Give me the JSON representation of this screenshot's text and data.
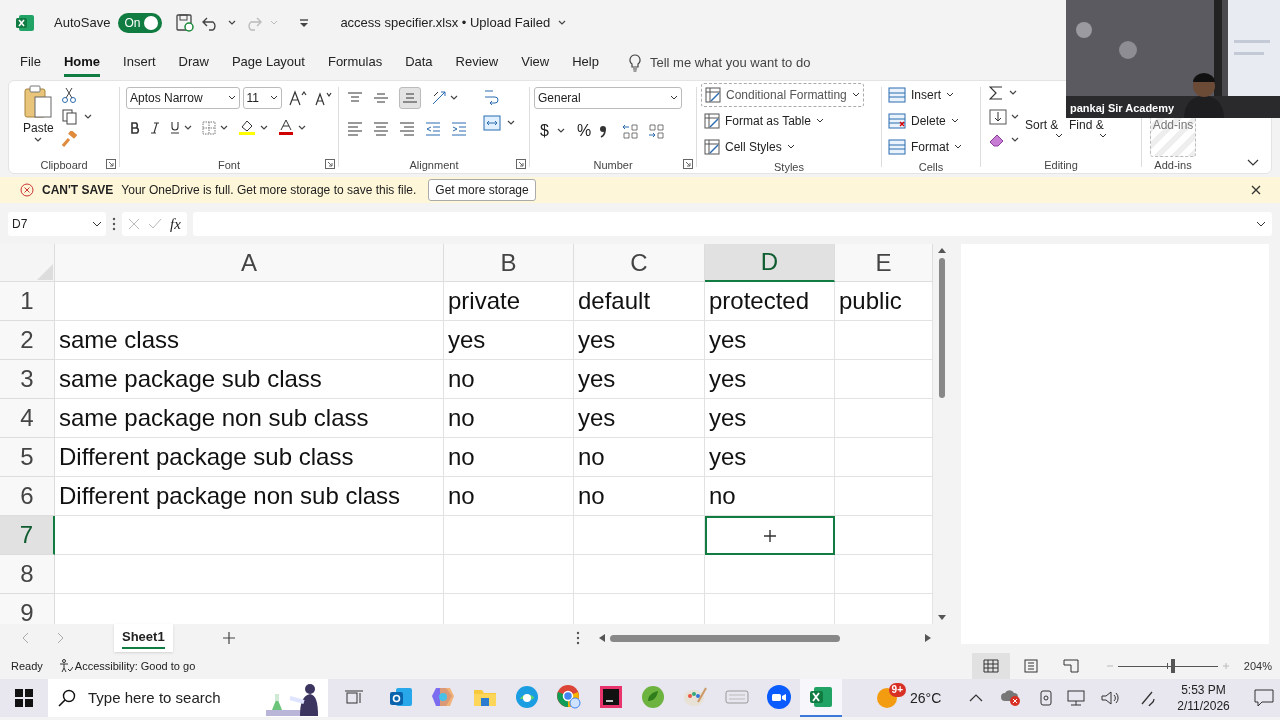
{
  "title_bar": {
    "autosave_label": "AutoSave",
    "autosave": {
      "on": true,
      "label": "On"
    },
    "document_title": "access specifier.xlsx • Upload Failed"
  },
  "menu_tabs": [
    {
      "label": "File",
      "selected": false
    },
    {
      "label": "Home",
      "selected": true
    },
    {
      "label": "Insert",
      "selected": false
    },
    {
      "label": "Draw",
      "selected": false
    },
    {
      "label": "Page Layout",
      "selected": false
    },
    {
      "label": "Formulas",
      "selected": false
    },
    {
      "label": "Data",
      "selected": false
    },
    {
      "label": "Review",
      "selected": false
    },
    {
      "label": "View",
      "selected": false
    },
    {
      "label": "Help",
      "selected": false
    }
  ],
  "tell_me": {
    "placeholder": "Tell me what you want to do"
  },
  "ribbon": {
    "clipboard": {
      "paste_label": "Paste",
      "group_label": "Clipboard"
    },
    "font": {
      "font_name": "Aptos Narrow",
      "font_size": "11",
      "group_label": "Font"
    },
    "alignment": {
      "group_label": "Alignment"
    },
    "number": {
      "format": "General",
      "currency": "$",
      "percent": "%",
      "group_label": "Number"
    },
    "styles": {
      "commands": [
        "Conditional Formatting",
        "Format as Table",
        "Cell Styles"
      ],
      "group_label": "Styles"
    },
    "cells": {
      "commands": [
        "Insert",
        "Delete",
        "Format"
      ],
      "group_label": "Cells"
    },
    "editing": {
      "commands": [
        "Sort &",
        "Find &"
      ],
      "group_label": "Editing"
    },
    "add_ins": {
      "command": "Add-ins",
      "group_label": "Add-ins"
    }
  },
  "message_bar": {
    "title": "CAN'T SAVE",
    "text": "Your OneDrive is full. Get more storage to save this file.",
    "button": "Get more storage"
  },
  "formula_bar": {
    "name_box": "D7",
    "function_label": "fx"
  },
  "sheet": {
    "columns": [
      {
        "label": "A",
        "selected": false
      },
      {
        "label": "B",
        "selected": false
      },
      {
        "label": "C",
        "selected": false
      },
      {
        "label": "D",
        "selected": true
      },
      {
        "label": "E",
        "selected": false
      }
    ],
    "rows": [
      {
        "number": "1",
        "selected": false,
        "cells": {
          "B": "private",
          "C": "default",
          "D": "protected",
          "E": "public"
        }
      },
      {
        "number": "2",
        "selected": false,
        "cells": {
          "A": "same class",
          "B": "yes",
          "C": "yes",
          "D": "yes"
        }
      },
      {
        "number": "3",
        "selected": false,
        "cells": {
          "A": "same package sub class",
          "B": "no",
          "C": "yes",
          "D": "yes"
        }
      },
      {
        "number": "4",
        "selected": false,
        "cells": {
          "A": "same package non sub class",
          "B": "no",
          "C": "yes",
          "D": "yes"
        }
      },
      {
        "number": "5",
        "selected": false,
        "cells": {
          "A": "Different package sub class",
          "B": "no",
          "C": "no",
          "D": "yes"
        }
      },
      {
        "number": "6",
        "selected": false,
        "cells": {
          "A": "Different package non sub class",
          "B": "no",
          "C": "no",
          "D": "no"
        }
      },
      {
        "number": "7",
        "selected": true,
        "cells": {}
      },
      {
        "number": "8",
        "selected": false,
        "cells": {}
      },
      {
        "number": "9",
        "selected": false,
        "cells": {}
      }
    ]
  },
  "sheet_tabs": [
    {
      "label": "Sheet1",
      "selected": true
    }
  ],
  "status_bar": {
    "ready": "Ready",
    "accessibility": "Accessibility: Good to go",
    "view_buttons": [
      {
        "kind": "normal",
        "selected": true
      },
      {
        "kind": "page_layout",
        "selected": false
      },
      {
        "kind": "page_break",
        "selected": false
      }
    ],
    "zoom_slider": {
      "level": 0.55
    },
    "zoom": "204%"
  },
  "video": {
    "caption": "pankaj Sir Academy"
  },
  "taskbar": {
    "search_placeholder": "Type here to search",
    "apps": [
      {
        "kind": "outlook",
        "selected": false
      },
      {
        "kind": "copilot",
        "selected": false
      },
      {
        "kind": "folder",
        "selected": false
      },
      {
        "kind": "edge",
        "selected": false
      },
      {
        "kind": "chrome",
        "selected": false
      },
      {
        "kind": "intellij",
        "selected": false
      },
      {
        "kind": "spring",
        "selected": false
      },
      {
        "kind": "paint",
        "selected": false
      },
      {
        "kind": "keyboard",
        "selected": false
      },
      {
        "kind": "zoom",
        "selected": false
      },
      {
        "kind": "excel",
        "selected": true
      }
    ],
    "weather": {
      "badge": "9+",
      "temperature": "26°C"
    },
    "time": "5:53 PM",
    "date": "2/11/2026"
  }
}
